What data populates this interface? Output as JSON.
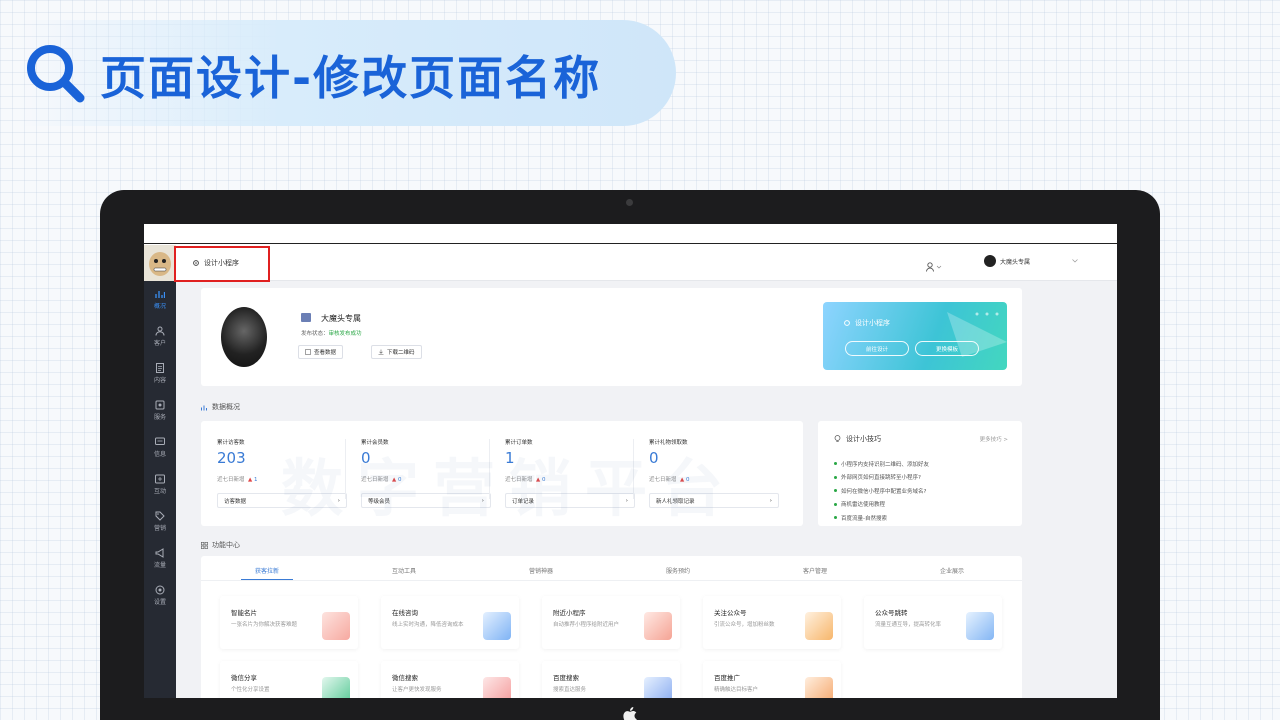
{
  "slide": {
    "title": "页面设计-修改页面名称",
    "accent": "#1a63d8",
    "title_icon": "search-icon"
  },
  "topbar": {
    "page_title": "设计小程序",
    "page_icon": "gear-icon",
    "account_icon": "person-icon",
    "shop_name": "大魔头专属"
  },
  "sidebar": {
    "items": [
      {
        "label": "概况",
        "icon": "chart-icon"
      },
      {
        "label": "客户",
        "icon": "user-icon"
      },
      {
        "label": "内容",
        "icon": "document-icon"
      },
      {
        "label": "服务",
        "icon": "service-icon"
      },
      {
        "label": "信息",
        "icon": "message-icon"
      },
      {
        "label": "互动",
        "icon": "interact-icon"
      },
      {
        "label": "营销",
        "icon": "tag-icon"
      },
      {
        "label": "流量",
        "icon": "megaphone-icon"
      },
      {
        "label": "设置",
        "icon": "settings-icon"
      }
    ]
  },
  "profile": {
    "name": "大魔头专属",
    "status_label": "发布状态：",
    "status_value": "审核发布成功",
    "btn_view": "查看数据",
    "btn_qr": "下载二维码"
  },
  "design_card": {
    "title": "设计小程序",
    "btn_go": "前往设计",
    "btn_template": "更换模板"
  },
  "overview": {
    "label": "数据概况",
    "stats": [
      {
        "label": "累计访客数",
        "value": "203",
        "week_label": "近七日新增",
        "week_value": "1",
        "link": "访客数据"
      },
      {
        "label": "累计会员数",
        "value": "0",
        "week_label": "近七日新增",
        "week_value": "0",
        "link": "等级会员"
      },
      {
        "label": "累计订单数",
        "value": "1",
        "week_label": "近七日新增",
        "week_value": "0",
        "link": "订单记录"
      },
      {
        "label": "累计礼物领取数",
        "value": "0",
        "week_label": "近七日新增",
        "week_value": "0",
        "link": "新人礼领取记录"
      }
    ]
  },
  "tips": {
    "title": "设计小技巧",
    "more": "更多技巧 >",
    "items": [
      "小程序内支持识别二维码、添加好友",
      "外部网页如何直接跳转至小程序?",
      "如何在微信小程序中配置业务域名?",
      "商机雷达使用教程",
      "百度流量-自然搜索"
    ]
  },
  "functions": {
    "label": "功能中心",
    "tabs": [
      "获客拉新",
      "互动工具",
      "营销神器",
      "服务预约",
      "客户管理",
      "企业展示"
    ],
    "cards": [
      {
        "title": "智能名片",
        "sub": "一张名片为你解决获客难题"
      },
      {
        "title": "在线咨询",
        "sub": "线上实时沟通，降低咨询成本"
      },
      {
        "title": "附近小程序",
        "sub": "自动推荐小程序给附近用户"
      },
      {
        "title": "关注公众号",
        "sub": "引流公众号，增加粉丝数"
      },
      {
        "title": "公众号跳转",
        "sub": "流量互通互导，提高转化率"
      },
      {
        "title": "微信分享",
        "sub": "个性化分享设置"
      },
      {
        "title": "微信搜索",
        "sub": "让客户更快发现服务"
      },
      {
        "title": "百度搜索",
        "sub": "搜索直达服务"
      },
      {
        "title": "百度推广",
        "sub": "精确触达目标客户"
      }
    ]
  },
  "watermark": "数字营销平台"
}
